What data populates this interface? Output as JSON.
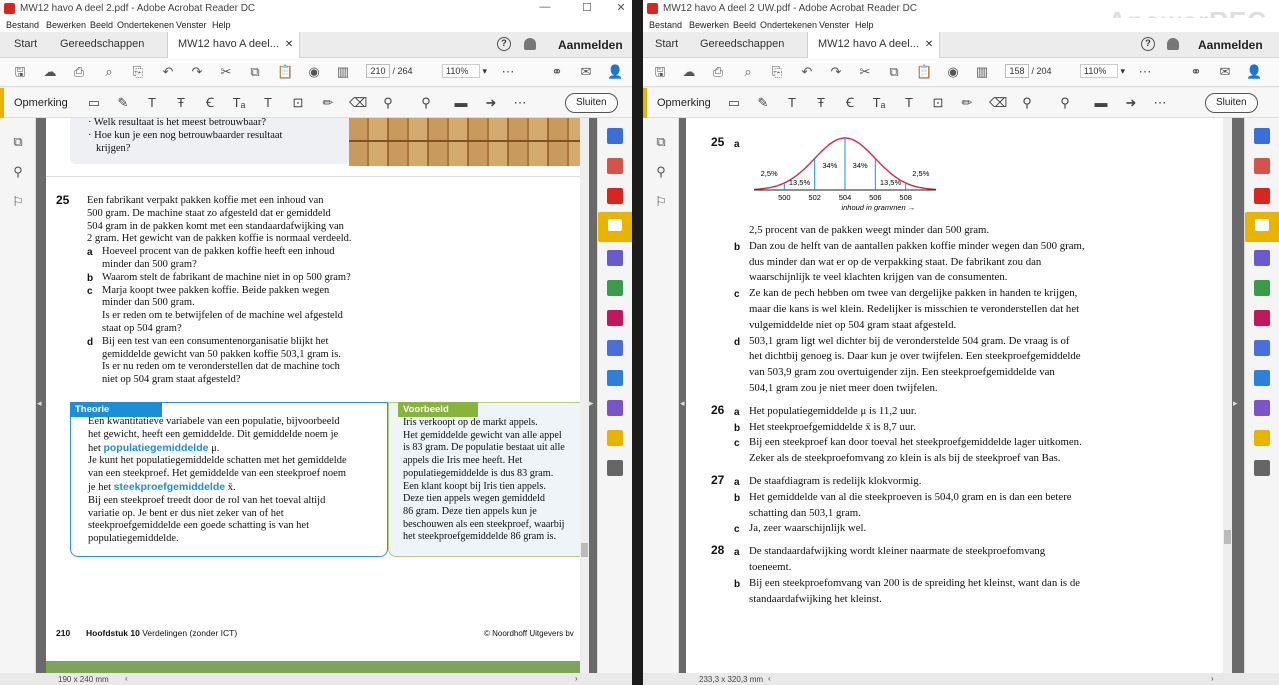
{
  "watermark": "ApowerREC",
  "left": {
    "title": "MW12 havo A deel 2.pdf - Adobe Acrobat Reader DC",
    "menu": [
      "Bestand",
      "Bewerken",
      "Beeld",
      "Ondertekenen",
      "Venster",
      "Help"
    ],
    "tabs": {
      "start": "Start",
      "tools": "Gereedschappen",
      "doc": "MW12 havo A deel...",
      "signin": "Aanmelden"
    },
    "page_current": "210",
    "page_total": "/ 264",
    "zoom": "110%",
    "comment_label": "Opmerking",
    "close_label": "Sluiten",
    "status": "190 x 240 mm",
    "top_lines": [
      "· Welk resultaat is het meest betrouwbaar?",
      "· Hoe kun je een nog betrouwbaarder resultaat",
      "krijgen?"
    ],
    "q25_num": "25",
    "q25_intro": [
      "Een fabrikant verpakt pakken koffie met een inhoud van",
      "500 gram. De machine staat zo afgesteld dat er gemiddeld",
      "504 gram in de pakken komt met een standaardafwijking van",
      "2 gram. Het gewicht van de pakken koffie is normaal verdeeld."
    ],
    "q25_items": [
      {
        "letter": "a",
        "lines": [
          "Hoeveel procent van de pakken koffie heeft een inhoud",
          "minder dan 500 gram?"
        ]
      },
      {
        "letter": "b",
        "lines": [
          "Waarom stelt de fabrikant de machine niet in op 500 gram?"
        ]
      },
      {
        "letter": "c",
        "lines": [
          "Marja koopt twee pakken koffie. Beide pakken wegen",
          "minder dan 500 gram.",
          "Is er reden om te betwijfelen of de machine wel afgesteld",
          "staat op 504 gram?"
        ]
      },
      {
        "letter": "d",
        "lines": [
          "Bij een test van een consumentenorganisatie blijkt het",
          "gemiddelde gewicht van 50 pakken koffie 503,1 gram is.",
          "Is er nu reden om te veronderstellen dat de machine toch",
          "niet op 504 gram staat afgesteld?"
        ]
      }
    ],
    "theory_header": "Theorie",
    "theory_lines": [
      "Een kwantitatieve variabele van een populatie, bijvoorbeeld",
      "het gewicht, heeft een gemiddelde. Dit gemiddelde noem je",
      "het",
      "populatiegemiddelde",
      "μ.",
      "Je kunt het populatiegemiddelde schatten met het gemiddelde",
      "van een steekproef. Het gemiddelde van een steekproef noem",
      "je het",
      "steekproefgemiddelde",
      "x̄.",
      "Bij een steekproef treedt door de rol van het toeval altijd",
      "variatie op. Je bent er dus niet zeker van of het",
      "steekproefgemiddelde een goede schatting is van het",
      "populatiegemiddelde."
    ],
    "example_header": "Voorbeeld",
    "example_lines": [
      "Iris verkoopt op de markt appels.",
      "Het gemiddelde gewicht van alle appel",
      "is 83 gram. De populatie bestaat uit alle",
      "appels die Iris mee heeft. Het",
      "populatiegemiddelde is dus 83 gram.",
      "Een klant koopt bij Iris tien appels.",
      "Deze tien appels wegen gemiddeld",
      "86 gram. Deze tien appels kun je",
      "beschouwen als een steekproef, waarbij",
      "het steekproefgemiddelde 86 gram is."
    ],
    "footer_page": "210",
    "footer_chapter": "Hoofdstuk 10",
    "footer_title": "Verdelingen (zonder ICT)",
    "footer_publisher": "© Noordhoff Uitgevers bv"
  },
  "right": {
    "title": "MW12 havo A deel 2 UW.pdf - Adobe Acrobat Reader DC",
    "menu": [
      "Bestand",
      "Bewerken",
      "Beeld",
      "Ondertekenen",
      "Venster",
      "Help"
    ],
    "tabs": {
      "start": "Start",
      "tools": "Gereedschappen",
      "doc": "MW12 havo A deel...",
      "signin": "Aanmelden"
    },
    "page_current": "158",
    "page_total": "/ 204",
    "zoom": "110%",
    "comment_label": "Opmerking",
    "close_label": "Sluiten",
    "status": "233,3 x 320,3 mm",
    "q25_num": "25",
    "q25_a": "a",
    "bell": {
      "percents": [
        "2,5%",
        "13,5%",
        "34%",
        "34%",
        "13,5%",
        "2,5%"
      ],
      "ticks": [
        "500",
        "502",
        "504",
        "506",
        "508"
      ],
      "axis_label": "inhoud in grammen →"
    },
    "answers": [
      {
        "num": "",
        "letter": "",
        "lines": [
          "2,5 procent van de pakken weegt minder dan 500 gram."
        ]
      },
      {
        "num": "",
        "letter": "b",
        "lines": [
          "Dan zou de helft van de aantallen pakken koffie minder wegen dan 500 gram,",
          "dus minder dan wat er op de verpakking staat. De fabrikant zou dan",
          "waarschijnlijk te veel klachten krijgen van de consumenten."
        ]
      },
      {
        "num": "",
        "letter": "c",
        "lines": [
          "Ze kan de pech hebben om twee van dergelijke pakken in handen te krijgen,",
          "maar die kans is wel klein. Redelijker is misschien te veronderstellen dat het",
          "vulgemiddelde niet op 504 gram staat afgesteld."
        ]
      },
      {
        "num": "",
        "letter": "d",
        "lines": [
          "503,1 gram ligt wel dichter bij de veronderstelde 504 gram. De vraag is of",
          "het dichtbij genoeg is. Daar kun je over twijfelen. Een steekproefgemiddelde",
          "van 503,9 gram zou overtuigender zijn. Een steekproefgemiddelde van",
          "504,1 gram zou je niet meer doen twijfelen."
        ]
      },
      {
        "num": "26",
        "letter": "a",
        "lines": [
          "Het populatiegemiddelde μ is 11,2 uur."
        ]
      },
      {
        "num": "",
        "letter": "b",
        "lines": [
          "Het steekproefgemiddelde x̄ is 8,7 uur."
        ]
      },
      {
        "num": "",
        "letter": "c",
        "lines": [
          "Bij een steekproef kan door toeval het steekproefgemiddelde lager uitkomen.",
          "Zeker als de steekproefomvang zo klein is als bij de steekproef van Bas."
        ]
      },
      {
        "num": "27",
        "letter": "a",
        "lines": [
          "De staafdiagram is redelijk klokvormig."
        ]
      },
      {
        "num": "",
        "letter": "b",
        "lines": [
          "Het gemiddelde van al die steekproeven is 504,0 gram en is dan een betere",
          "schatting dan 503,1 gram."
        ]
      },
      {
        "num": "",
        "letter": "c",
        "lines": [
          "Ja, zeer waarschijnlijk wel."
        ]
      },
      {
        "num": "28",
        "letter": "a",
        "lines": [
          "De standaardafwijking wordt kleiner naarmate de steekproefomvang",
          "toeneemt."
        ]
      },
      {
        "num": "",
        "letter": "b",
        "lines": [
          "Bij een steekproefomvang van 200 is de spreiding het kleinst, want dan is de",
          "standaardafwijking het kleinst."
        ]
      }
    ]
  },
  "colors": {
    "accent": "#e8b400",
    "theory_blue": "#1a8fd7",
    "example_green": "#86b43c",
    "acrobat_red": "#d7261e"
  }
}
